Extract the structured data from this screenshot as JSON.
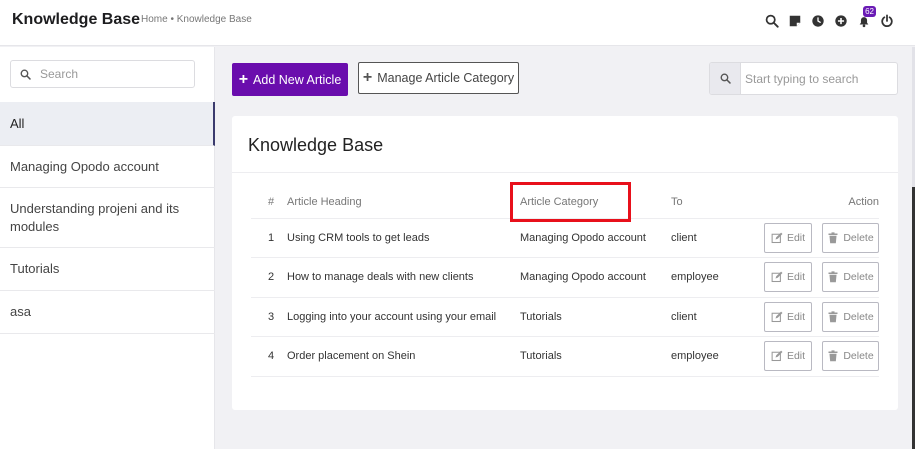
{
  "header": {
    "title": "Knowledge Base",
    "breadcrumb": "Home • Knowledge Base",
    "notification_count": "62",
    "icons": [
      "search-icon",
      "sticky-note-icon",
      "clock-icon",
      "plus-circle-icon",
      "bell-icon",
      "power-icon"
    ]
  },
  "sidebar": {
    "search_placeholder": "Search",
    "items": [
      {
        "label": "All",
        "active": true
      },
      {
        "label": "Managing Opodo account"
      },
      {
        "label": "Understanding projeni and its modules"
      },
      {
        "label": "Tutorials"
      },
      {
        "label": "asa"
      }
    ]
  },
  "toolbar": {
    "add_article_label": "Add New Article",
    "manage_category_label": "Manage Article Category",
    "search_placeholder": "Start typing to search"
  },
  "card": {
    "title": "Knowledge Base"
  },
  "table": {
    "headers": {
      "num": "#",
      "heading": "Article Heading",
      "category": "Article Category",
      "to": "To",
      "action": "Action"
    },
    "rows": [
      {
        "num": "1",
        "heading": "Using CRM tools to get leads",
        "category": "Managing Opodo account",
        "to": "client"
      },
      {
        "num": "2",
        "heading": "How to manage deals with new clients",
        "category": "Managing Opodo account",
        "to": "employee"
      },
      {
        "num": "3",
        "heading": "Logging into your account using your email",
        "category": "Tutorials",
        "to": "client"
      },
      {
        "num": "4",
        "heading": "Order placement on Shein",
        "category": "Tutorials",
        "to": "employee"
      }
    ],
    "edit_label": "Edit",
    "delete_label": "Delete"
  },
  "colors": {
    "primary": "#6a0dad",
    "badge": "#6a1bb5",
    "highlight": "#e8101b"
  }
}
